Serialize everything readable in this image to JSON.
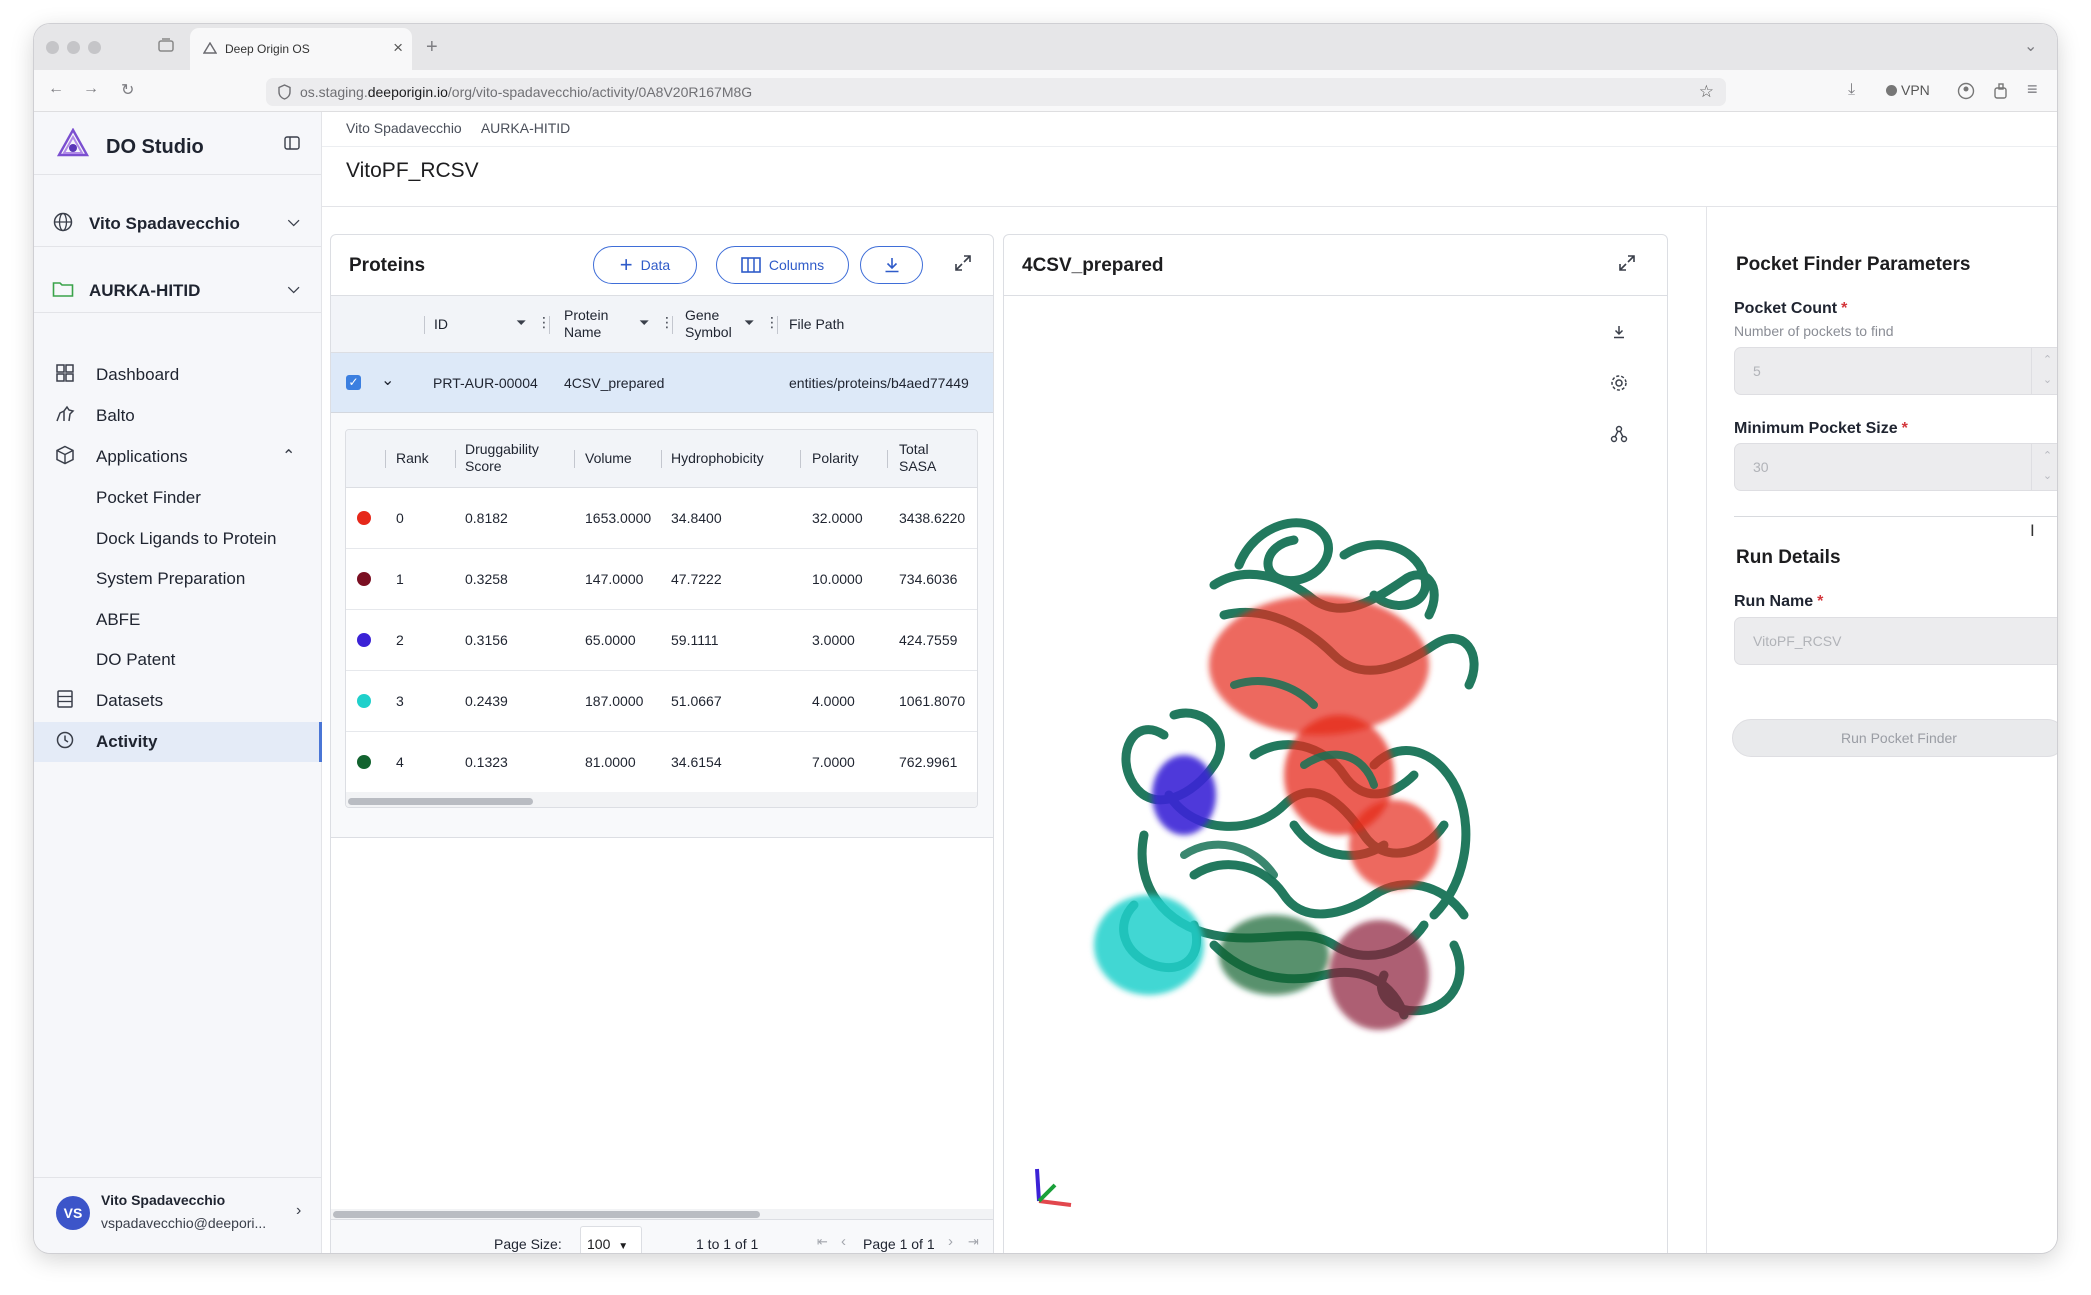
{
  "browser": {
    "tab_title": "Deep Origin OS",
    "url_prefix": "os.staging.",
    "url_domain": "deeporigin.io",
    "url_path": "/org/vito-spadavecchio/activity/0A8V20R167M8G",
    "vpn_label": "VPN"
  },
  "sidebar": {
    "app_name": "DO Studio",
    "org_name": "Vito Spadavecchio",
    "project_name": "AURKA-HITID",
    "nav": {
      "dashboard": "Dashboard",
      "balto": "Balto",
      "applications": "Applications",
      "pocket_finder": "Pocket Finder",
      "dock_ligands": "Dock Ligands to Protein",
      "system_prep": "System Preparation",
      "abfe": "ABFE",
      "do_patent": "DO Patent",
      "datasets": "Datasets",
      "activity": "Activity"
    },
    "user": {
      "initials": "VS",
      "name": "Vito Spadavecchio",
      "email": "vspadavecchio@deepori..."
    }
  },
  "breadcrumb": [
    "Vito Spadavecchio",
    "AURKA-HITID"
  ],
  "run_title": "VitoPF_RCSV",
  "proteins": {
    "title": "Proteins",
    "data_button": "Data",
    "columns_button": "Columns",
    "columns": [
      "ID",
      "Protein Name",
      "Gene Symbol",
      "File Path"
    ],
    "row": {
      "id": "PRT-AUR-00004",
      "name": "4CSV_prepared",
      "gene": "",
      "path": "entities/proteins/b4aed77449"
    },
    "pocket_columns": [
      "Rank",
      "Druggability Score",
      "Volume",
      "Hydrophobicity",
      "Polarity",
      "Total SASA"
    ],
    "pockets": [
      {
        "color": "#e6281a",
        "rank": "0",
        "score": "0.8182",
        "volume": "1653.0000",
        "hydro": "34.8400",
        "polarity": "32.0000",
        "sasa": "3438.6220"
      },
      {
        "color": "#7a0f22",
        "rank": "1",
        "score": "0.3258",
        "volume": "147.0000",
        "hydro": "47.7222",
        "polarity": "10.0000",
        "sasa": "734.6036"
      },
      {
        "color": "#3b22d6",
        "rank": "2",
        "score": "0.3156",
        "volume": "65.0000",
        "hydro": "59.1111",
        "polarity": "3.0000",
        "sasa": "424.7559"
      },
      {
        "color": "#1fd0cb",
        "rank": "3",
        "score": "0.2439",
        "volume": "187.0000",
        "hydro": "51.0667",
        "polarity": "4.0000",
        "sasa": "1061.8070"
      },
      {
        "color": "#12632f",
        "rank": "4",
        "score": "0.1323",
        "volume": "81.0000",
        "hydro": "34.6154",
        "polarity": "7.0000",
        "sasa": "762.9961"
      }
    ],
    "footer": {
      "page_size_label": "Page Size:",
      "page_size_value": "100",
      "range": "1 to 1 of 1",
      "page": "Page 1 of 1"
    }
  },
  "viewer": {
    "title": "4CSV_prepared"
  },
  "params": {
    "title": "Pocket Finder Parameters",
    "pocket_count_label": "Pocket Count",
    "pocket_count_hint": "Number of pockets to find",
    "pocket_count_value": "5",
    "min_size_label": "Minimum Pocket Size",
    "min_size_value": "30",
    "run_details_title": "Run Details",
    "run_name_label": "Run Name",
    "run_name_value": "VitoPF_RCSV",
    "run_button": "Run Pocket Finder"
  }
}
